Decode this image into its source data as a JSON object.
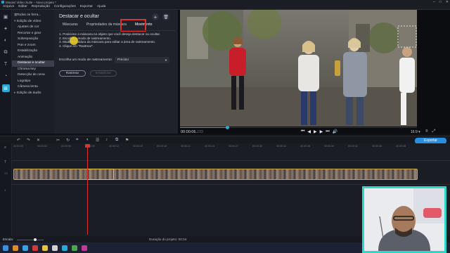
{
  "window": {
    "title": "Movavi Video Suite – Novo projeto *"
  },
  "menu": [
    "Arquivo",
    "Editar",
    "Reprodução",
    "Configurações",
    "Exportar",
    "Ajuda"
  ],
  "sidebar": {
    "items": [
      {
        "label": "Todos os ferra...",
        "type": "category"
      },
      {
        "label": "Edição de vídeo",
        "type": "category"
      },
      {
        "label": "Ajustes de cor"
      },
      {
        "label": "Recortar e girar"
      },
      {
        "label": "Sobreposição"
      },
      {
        "label": "Pan e zoom"
      },
      {
        "label": "Estabilização"
      },
      {
        "label": "Animação"
      },
      {
        "label": "Destacar e ocultar",
        "active": true
      },
      {
        "label": "Chroma key"
      },
      {
        "label": "Detecção de cena"
      },
      {
        "label": "Logotipo"
      },
      {
        "label": "Câmera lenta"
      },
      {
        "label": "Edição de áudio",
        "type": "category"
      }
    ]
  },
  "panel": {
    "title": "Destacar e ocultar",
    "tabs": [
      "Máscaras",
      "Propriedades da máscara",
      "Movimento"
    ],
    "active_tab": "Movimento",
    "instructions": [
      "1. Posicione a máscara no objeto que você deseja destacar ou ocultar.",
      "2. Escolha o modo de rastreamento.",
      "3. Mude a moldura da máscara para editar a área de rastreamento.",
      "4. Clique em \"Rastrear\"."
    ],
    "tracking_label": "Escolha um modo de rastreamento:",
    "tracking_value": "Preciso",
    "track_button": "Rastrear",
    "stabilize_button": "Estabilizar"
  },
  "player": {
    "timecode_main": "00:00:06.",
    "timecode_frac": "233",
    "aspect_ratio": "16:9 ▾",
    "progress": 0.2
  },
  "toolbar": {
    "export_label": "Exportar"
  },
  "timeline": {
    "ruler_ticks": [
      "00:00:00",
      "00:00:03",
      "00:00:06",
      "00:00:09",
      "00:00:12",
      "00:00:15",
      "00:00:18",
      "00:00:21",
      "00:00:24",
      "00:00:27",
      "00:00:30",
      "00:00:33",
      "00:00:36",
      "00:00:39",
      "00:00:42",
      "00:00:45",
      "00:00:48"
    ]
  },
  "status": {
    "zoom_label": "Escala:",
    "duration_label": "Duração do projeto:",
    "duration_value": "00:34"
  },
  "colors": {
    "accent": "#2aa8d8",
    "highlight_red": "#e0302c",
    "webcam_border": "#2ed8c8"
  }
}
